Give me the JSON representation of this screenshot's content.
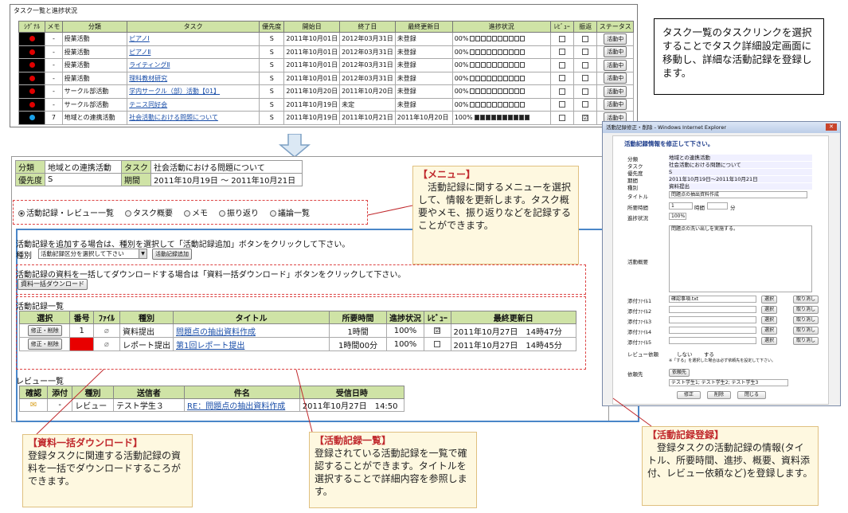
{
  "task_list": {
    "caption": "タスク一覧と進捗状況",
    "headers": [
      "ｼｸﾞﾅﾙ",
      "メモ",
      "分類",
      "タスク",
      "優先度",
      "開始日",
      "終了日",
      "最終更新日",
      "進捗状況",
      "ﾚﾋﾞｭｰ",
      "振返",
      "ステータス"
    ],
    "rows": [
      {
        "signal": "#e00000",
        "memo": "-",
        "category": "授業活動",
        "task": "ピアノⅠ",
        "priority": "S",
        "start": "2011年10月01日",
        "end": "2012年03月31日",
        "updated": "未登録",
        "progress": "00%",
        "filled": 0,
        "review": "",
        "reflect": "",
        "status": "活動中"
      },
      {
        "signal": "#e00000",
        "memo": "-",
        "category": "授業活動",
        "task": "ピアノⅡ",
        "priority": "S",
        "start": "2011年10月01日",
        "end": "2012年03月31日",
        "updated": "未登録",
        "progress": "00%",
        "filled": 0,
        "review": "",
        "reflect": "",
        "status": "活動中"
      },
      {
        "signal": "#e00000",
        "memo": "-",
        "category": "授業活動",
        "task": "ライティングⅡ",
        "priority": "S",
        "start": "2011年10月01日",
        "end": "2012年03月31日",
        "updated": "未登録",
        "progress": "00%",
        "filled": 0,
        "review": "",
        "reflect": "",
        "status": "活動中"
      },
      {
        "signal": "#e00000",
        "memo": "-",
        "category": "授業活動",
        "task": "理科教材研究",
        "priority": "S",
        "start": "2011年10月01日",
        "end": "2012年03月31日",
        "updated": "未登録",
        "progress": "00%",
        "filled": 0,
        "review": "",
        "reflect": "",
        "status": "活動中"
      },
      {
        "signal": "#e00000",
        "memo": "-",
        "category": "サークル部活動",
        "task": "学内サークル（部）活動【01】",
        "priority": "S",
        "start": "2011年10月20日",
        "end": "2011年10月20日",
        "updated": "未登録",
        "progress": "00%",
        "filled": 0,
        "review": "",
        "reflect": "",
        "status": "活動中"
      },
      {
        "signal": "#e00000",
        "memo": "-",
        "category": "サークル部活動",
        "task": "テニス同好会",
        "priority": "S",
        "start": "2011年10月19日",
        "end": "未定",
        "updated": "未登録",
        "progress": "00%",
        "filled": 0,
        "review": "",
        "reflect": "",
        "status": "活動中"
      },
      {
        "signal": "#1aa0e8",
        "memo": "7",
        "category": "地域との連携活動",
        "task": "社会活動における問題について",
        "priority": "S",
        "start": "2011年10月19日",
        "end": "2011年10月21日",
        "updated": "2011年10月20日",
        "progress": "100%",
        "filled": 10,
        "review": "",
        "reflect": "☑",
        "status": "活動中"
      }
    ]
  },
  "top_note": "タスク一覧のタスクリンクを選択することでタスク詳細設定画面に移動し、詳細な活動記録を登録します。",
  "detail": {
    "category_label": "分類",
    "category": "地域との連携活動",
    "task_label": "タスク",
    "task": "社会活動における問題について",
    "priority_label": "優先度",
    "priority": "S",
    "period_label": "期間",
    "period": "2011年10月19日 ～ 2011年10月21日"
  },
  "menu": {
    "items": [
      "活動記録・レビュー一覧",
      "タスク概要",
      "メモ",
      "振り返り",
      "議論一覧"
    ],
    "selected": 0
  },
  "add_section": {
    "instruction": "活動記録を追加する場合は、種別を選択して「活動記録追加」ボタンをクリックして下さい。",
    "type_label": "種別",
    "select_value": "活動記録区分を選択して下さい",
    "add_button": "活動記録追加"
  },
  "download": {
    "instruction": "活動記録の資料を一括してダウンロードする場合は「資料一括ダウンロード」ボタンをクリックして下さい。",
    "button": "資料一括ダウンロード"
  },
  "activity_list": {
    "caption": "活動記録一覧",
    "headers": [
      "選択",
      "番号",
      "ﾌｧｲﾙ",
      "種別",
      "タイトル",
      "所要時間",
      "進捗状況",
      "ﾚﾋﾞｭｰ",
      "最終更新日"
    ],
    "rows": [
      {
        "action": "修正・削除",
        "number": "1",
        "type": "資料提出",
        "title": "問題点の抽出資料作成",
        "time": "1時間",
        "progress": "100%",
        "review": "☑",
        "updated": "2011年10月27日　14時47分",
        "highlight": false
      },
      {
        "action": "修正・削除",
        "number": "2",
        "type": "レポート提出",
        "title": "第1回レポート提出",
        "time": "1時間00分",
        "progress": "100%",
        "review": "",
        "updated": "2011年10月27日　14時45分",
        "highlight": true
      }
    ]
  },
  "review_list": {
    "caption": "レビュー一覧",
    "headers": [
      "確認",
      "添付",
      "種別",
      "送信者",
      "件名",
      "受信日時"
    ],
    "rows": [
      {
        "confirm": "✉",
        "attach": "-",
        "type": "レビュー",
        "sender": "テスト学生３",
        "subject": "RE：問題点の抽出資料作成",
        "received": "2011年10月27日　14:50"
      }
    ]
  },
  "notes": {
    "menu": {
      "title": "【メニュー】",
      "body": "　活動記録に関するメニューを選択して、情報を更新します。タスク概要やメモ、振り返りなどを記録することができます。"
    },
    "download": {
      "title": "【資料一括ダウンロード】",
      "body": "登録タスクに関連する活動記録の資料を一括でダウンロードするころができます。"
    },
    "list": {
      "title": "【活動記録一覧】",
      "body": "登録されている活動記録を一覧で確認することができます。タイトルを選択することで詳細内容を参照します。"
    },
    "register": {
      "title": "【活動記録登録】",
      "body": "　登録タスクの活動記録の情報(タイトル、所要時間、進捗、概要、資料添付、レビュー依頼など)を登録します。"
    }
  },
  "dialog": {
    "window_title": "活動記録修正・削除 - Windows Internet Explorer",
    "heading": "活動記録情報を修正して下さい。",
    "fields": [
      {
        "label": "分類",
        "value": "地域との連携活動"
      },
      {
        "label": "タスク",
        "value": "社会活動における問題について"
      },
      {
        "label": "優先度",
        "value": "S"
      },
      {
        "label": "期間",
        "value": "2011年10月19日～2011年10月21日"
      },
      {
        "label": "種別",
        "value": "資料提出"
      }
    ],
    "title_label": "タイトル",
    "title_value": "問題点の抽出資料作成",
    "time_label": "所要時間",
    "hours": "1",
    "hours_unit": "時間",
    "minutes_unit": "分",
    "progress_label": "進捗状況",
    "progress_value": "100%",
    "summary_label": "活動概要",
    "summary_value": "問題点の洗い出しを実施する。",
    "attachments": [
      {
        "label": "添付ﾌｧｲﾙ1",
        "value": "確認事項.txt"
      },
      {
        "label": "添付ﾌｧｲﾙ2",
        "value": ""
      },
      {
        "label": "添付ﾌｧｲﾙ3",
        "value": ""
      },
      {
        "label": "添付ﾌｧｲﾙ4",
        "value": ""
      },
      {
        "label": "添付ﾌｧｲﾙ5",
        "value": ""
      }
    ],
    "select_btn": "選択",
    "clear_btn": "取り消し",
    "review_label": "レビュー依頼",
    "review_no": "しない",
    "review_yes": "する",
    "review_note": "※「する」を選択した場合は必ず依頼先を設定して下さい。",
    "request_label": "依頼先",
    "request_btn": "依頼先",
    "request_value": "テスト学生1; テスト学生2; テスト学生3",
    "buttons": [
      "修正",
      "削除",
      "閉じる"
    ]
  },
  "colors": {
    "header_green": "#cfe3a6",
    "link_blue": "#1a4ea8",
    "accent_blue": "#4a86c8",
    "note_red": "#c0282c"
  }
}
